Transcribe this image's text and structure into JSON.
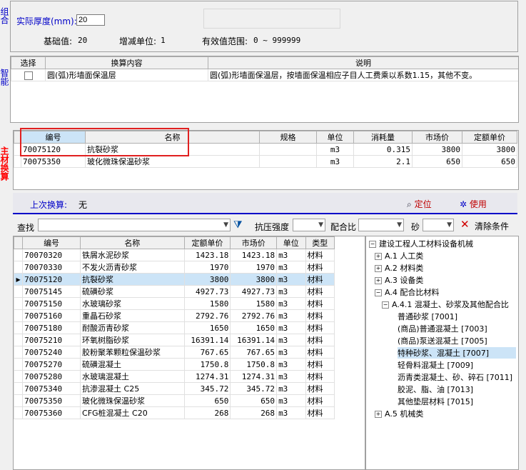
{
  "side_tabs": {
    "tab1": "组合",
    "tab2": "智能",
    "tab3": "主材换算"
  },
  "top": {
    "thickness_label": "实际厚度(mm):",
    "thickness_value": "20",
    "base_label": "基础值:",
    "base_value": "20",
    "step_label": "增减单位:",
    "step_value": "1",
    "range_label": "有效值范围:",
    "range_value": "0 ~ 999999"
  },
  "conversion_table": {
    "headers": [
      "选择",
      "换算内容",
      "说明"
    ],
    "rows": [
      {
        "selected": false,
        "content": "圆(弧)形墙面保温层",
        "note": "圆(弧)形墙面保温层，按墙面保温相应子目人工费乘以系数1.15，其他不变。"
      }
    ]
  },
  "material_table": {
    "headers": [
      "编号",
      "名称",
      "规格",
      "单位",
      "消耗量",
      "市场价",
      "定额单价"
    ],
    "rows": [
      {
        "code": "70075120",
        "name": "抗裂砂浆",
        "spec": "",
        "unit": "m3",
        "qty": "0.315",
        "market": "3800",
        "price": "3800"
      },
      {
        "code": "70075350",
        "name": "玻化微珠保温砂浆",
        "spec": "",
        "unit": "m3",
        "qty": "2.1",
        "market": "650",
        "price": "650"
      }
    ]
  },
  "last_conversion": {
    "label": "上次换算:",
    "value": "无"
  },
  "actions": {
    "locate": "定位",
    "use": "使用"
  },
  "filter": {
    "search_label": "查找",
    "search_value": "",
    "strength_label": "抗压强度",
    "ratio_label": "配合比",
    "sand_label": "砂",
    "clear_label": "清除条件"
  },
  "list_table": {
    "headers": [
      "编号",
      "名称",
      "定额单价",
      "市场价",
      "单位",
      "类型"
    ],
    "rows": [
      {
        "code": "70070320",
        "name": "铁屑水泥砂浆",
        "price": "1423.18",
        "market": "1423.18",
        "unit": "m3",
        "type": "材料"
      },
      {
        "code": "70070330",
        "name": "不发火沥青砂浆",
        "price": "1970",
        "market": "1970",
        "unit": "m3",
        "type": "材料"
      },
      {
        "code": "70075120",
        "name": "抗裂砂浆",
        "price": "3800",
        "market": "3800",
        "unit": "m3",
        "type": "材料"
      },
      {
        "code": "70075145",
        "name": "硫磺砂浆",
        "price": "4927.73",
        "market": "4927.73",
        "unit": "m3",
        "type": "材料"
      },
      {
        "code": "70075150",
        "name": "水玻璃砂浆",
        "price": "1580",
        "market": "1580",
        "unit": "m3",
        "type": "材料"
      },
      {
        "code": "70075160",
        "name": "重晶石砂浆",
        "price": "2792.76",
        "market": "2792.76",
        "unit": "m3",
        "type": "材料"
      },
      {
        "code": "70075180",
        "name": "耐酸沥青砂浆",
        "price": "1650",
        "market": "1650",
        "unit": "m3",
        "type": "材料"
      },
      {
        "code": "70075210",
        "name": "环氧树脂砂浆",
        "price": "16391.14",
        "market": "16391.14",
        "unit": "m3",
        "type": "材料"
      },
      {
        "code": "70075240",
        "name": "胶粉聚苯颗粒保温砂浆",
        "price": "767.65",
        "market": "767.65",
        "unit": "m3",
        "type": "材料"
      },
      {
        "code": "70075270",
        "name": "硫磺混凝土",
        "price": "1750.8",
        "market": "1750.8",
        "unit": "m3",
        "type": "材料"
      },
      {
        "code": "70075280",
        "name": "水玻璃混凝土",
        "price": "1274.31",
        "market": "1274.31",
        "unit": "m3",
        "type": "材料"
      },
      {
        "code": "70075340",
        "name": "抗渗混凝土 C25",
        "price": "345.72",
        "market": "345.72",
        "unit": "m3",
        "type": "材料"
      },
      {
        "code": "70075350",
        "name": "玻化微珠保温砂浆",
        "price": "650",
        "market": "650",
        "unit": "m3",
        "type": "材料"
      },
      {
        "code": "70075360",
        "name": "CFG桩混凝土 C20",
        "price": "268",
        "market": "268",
        "unit": "m3",
        "type": "材料"
      }
    ]
  },
  "tree": {
    "root": "建设工程人工材料设备机械",
    "a1": "A.1 人工类",
    "a2": "A.2 材料类",
    "a3": "A.3 设备类",
    "a4": "A.4 配合比材料",
    "a41": "A.4.1 混凝土、砂浆及其他配合比",
    "c1": "普通砂浆 [7001]",
    "c2": "(商品)普通混凝土 [7003]",
    "c3": "(商品)泵送混凝土 [7005]",
    "c4": "特种砂浆、混凝土 [7007]",
    "c5": "轻骨料混凝土 [7009]",
    "c6": "沥青类混凝土、砂、碎石 [7011]",
    "c7": "胶泥、脂、油 [7013]",
    "c8": "其他垫层材料 [7015]",
    "a5": "A.5 机械类"
  }
}
